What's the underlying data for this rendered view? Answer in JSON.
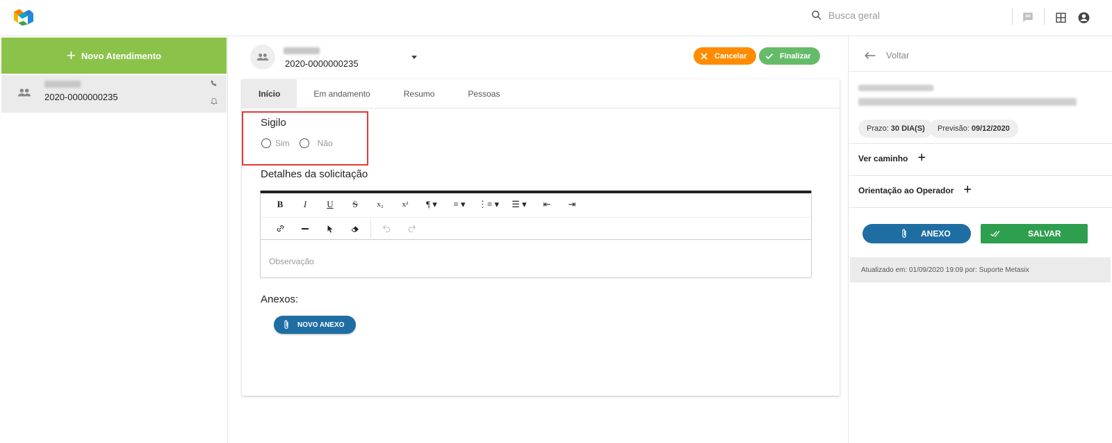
{
  "header": {
    "search_placeholder": "Busca geral"
  },
  "left": {
    "new_button": "Novo Atendimento",
    "ticket": {
      "number": "2020-0000000235"
    }
  },
  "center": {
    "ticket_number": "2020-0000000235",
    "actions": {
      "cancel": "Cancelar",
      "finish": "Finalizar"
    },
    "tabs": [
      "Início",
      "Em andamento",
      "Resumo",
      "Pessoas"
    ],
    "sigilo": {
      "title": "Sigilo",
      "options": [
        "Sim",
        "Não"
      ]
    },
    "details_title": "Detalhes da solicitação",
    "toolbar": {
      "row1": [
        "B",
        "I",
        "U",
        "S",
        "x₂",
        "x²",
        "¶ ▾",
        "≡ ▾",
        "⋮≡ ▾",
        "☰ ▾",
        "⇤",
        "⇥"
      ],
      "row2": [
        "link",
        "hr",
        "pointer",
        "eraser",
        "undo",
        "redo"
      ]
    },
    "editor_placeholder": "Observação",
    "attachments_title": "Anexos:",
    "new_attachment": "NOVO ANEXO"
  },
  "right": {
    "back": "Voltar",
    "prazo_label": "Prazo:",
    "prazo_value": "30 DIA(S)",
    "previsao_label": "Previsão:",
    "previsao_value": "09/12/2020",
    "ver_caminho": "Ver caminho",
    "orientacao": "Orientação ao Operador",
    "anexo_button": "ANEXO",
    "salvar_button": "SALVAR",
    "updated": "Atualizado em: 01/09/2020 19:09 por: Suporte Metasix"
  },
  "colors": {
    "green_new": "#8bc34a",
    "orange_cancel": "#ff8c00",
    "green_finish": "#66bb6a",
    "blue_button": "#1f6ea3",
    "green_save": "#2e9e4f",
    "highlight_red": "#e53935"
  }
}
